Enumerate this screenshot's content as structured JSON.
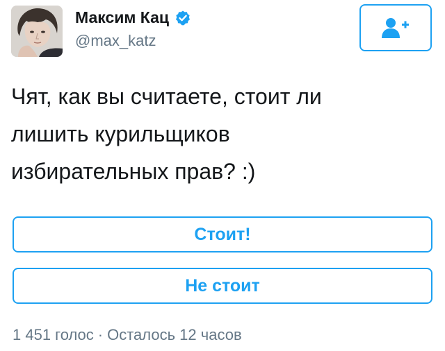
{
  "author": {
    "display_name": "Максим Кац",
    "handle": "@max_katz",
    "verified": true,
    "verified_icon": "verified-badge-icon"
  },
  "follow_button": {
    "icon": "add-user-icon"
  },
  "tweet": {
    "text_lines": [
      "Чят, как вы считаете, стоит ли",
      "лишить курильщиков",
      "избирательных прав? :)"
    ]
  },
  "poll": {
    "options": [
      {
        "label": "Стоит!"
      },
      {
        "label": "Не стоит"
      }
    ],
    "votes": "1 451 голос",
    "separator": "·",
    "time_left": "Осталось 12 часов"
  },
  "colors": {
    "accent": "#1da1f2",
    "text": "#14171a",
    "secondary": "#657786"
  }
}
